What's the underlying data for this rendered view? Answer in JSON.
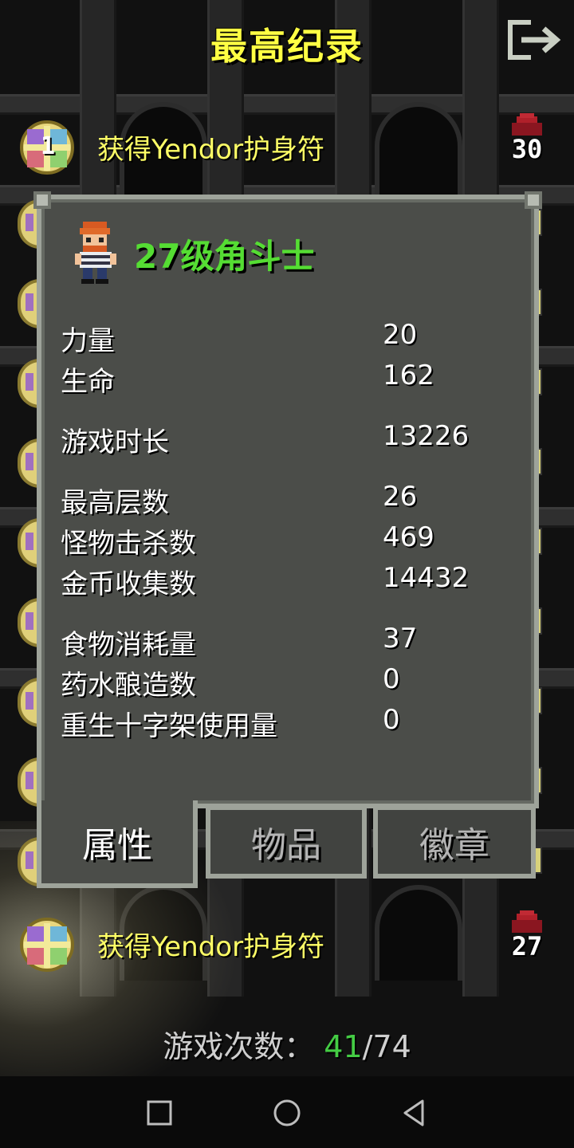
{
  "header": {
    "title": "最高纪录",
    "exit_icon": "exit-icon"
  },
  "records": [
    {
      "text": "获得Yendor护身符",
      "rank": "1",
      "depth": "30"
    },
    {
      "text": "获得Yendor护身符",
      "depth": "27"
    }
  ],
  "dialog": {
    "hero_title": "27级角斗士",
    "hero_icon": "gladiator-icon",
    "stats": [
      {
        "label": "力量",
        "value": "20"
      },
      {
        "label": "生命",
        "value": "162"
      },
      {
        "label": "游戏时长",
        "value": "13226"
      },
      {
        "label": "最高层数",
        "value": "26"
      },
      {
        "label": "怪物击杀数",
        "value": "469"
      },
      {
        "label": "金币收集数",
        "value": "14432"
      },
      {
        "label": "食物消耗量",
        "value": "37"
      },
      {
        "label": "药水酿造数",
        "value": "0"
      },
      {
        "label": "重生十字架使用量",
        "value": "0"
      }
    ],
    "tabs": [
      {
        "label": "属性",
        "active": true
      },
      {
        "label": "物品",
        "active": false
      },
      {
        "label": "徽章",
        "active": false
      }
    ]
  },
  "footer": {
    "games_label": "游戏次数：",
    "games_won": "41",
    "games_sep_total": "/74"
  },
  "colors": {
    "title": "#ffff44",
    "record_text": "#ffff66",
    "hero_title": "#55dd33",
    "won_count": "#44cc44",
    "panel": "#4b4d49"
  },
  "navbar": {
    "icons": [
      "recent-apps-icon",
      "home-icon",
      "back-icon"
    ]
  }
}
